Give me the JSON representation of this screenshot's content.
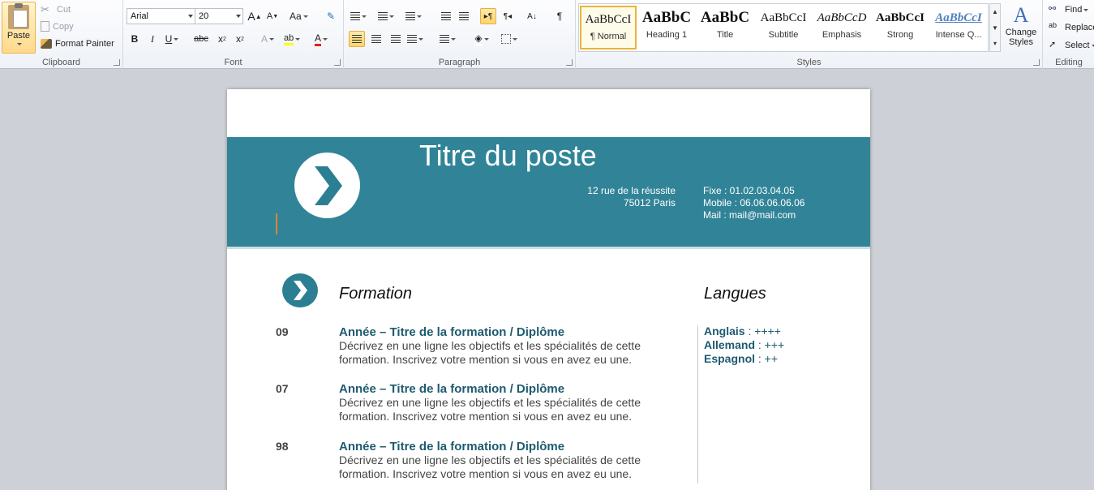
{
  "ribbon": {
    "clipboard": {
      "label": "Clipboard",
      "paste": "Paste",
      "cut": "Cut",
      "copy": "Copy",
      "format_painter": "Format Painter"
    },
    "font": {
      "label": "Font",
      "family": "Arial",
      "size": "20",
      "grow": "A",
      "shrink": "A",
      "change_case": "Aa",
      "bold": "B",
      "italic": "I",
      "underline": "U",
      "strike": "abc",
      "subscript": "x",
      "superscript": "x",
      "font_color": "A"
    },
    "paragraph": {
      "label": "Paragraph",
      "pilcrow": "¶"
    },
    "styles": {
      "label": "Styles",
      "items": [
        {
          "sample": "AaBbCcI",
          "name": "¶ Normal"
        },
        {
          "sample": "AaBbC",
          "name": "Heading 1"
        },
        {
          "sample": "AaBbC",
          "name": "Title"
        },
        {
          "sample": "AaBbCcI",
          "name": "Subtitle"
        },
        {
          "sample": "AaBbCcD",
          "name": "Emphasis"
        },
        {
          "sample": "AaBbCcI",
          "name": "Strong"
        },
        {
          "sample": "AaBbCcI",
          "name": "Intense Q..."
        }
      ],
      "change_styles": "Change Styles"
    },
    "editing": {
      "label": "Editing",
      "find": "Find",
      "replace": "Replace",
      "select": "Select"
    }
  },
  "document": {
    "job_title": "Titre du poste",
    "address_line1": "12 rue de la réussite",
    "address_line2": "75012 Paris",
    "phone_fixed": "Fixe : 01.02.03.04.05",
    "phone_mobile": "Mobile : 06.06.06.06.06",
    "mail": "Mail : mail@mail.com",
    "formation_title": "Formation",
    "langues_title": "Langues",
    "entries": [
      {
        "year": "09",
        "title": "Année – Titre de la formation / Diplôme",
        "desc1": "Décrivez en une ligne les objectifs et les spécialités de cette",
        "desc2": "formation. Inscrivez votre mention si vous en avez eu une."
      },
      {
        "year": "07",
        "title": "Année – Titre de la formation / Diplôme",
        "desc1": "Décrivez en une ligne les objectifs et les spécialités de cette",
        "desc2": "formation. Inscrivez votre mention si vous en avez eu une."
      },
      {
        "year": "98",
        "title": "Année – Titre de la formation / Diplôme",
        "desc1": "Décrivez en une ligne les objectifs et les spécialités de cette",
        "desc2": "formation. Inscrivez votre mention si vous en avez eu une."
      }
    ],
    "languages": [
      {
        "name": "Anglais",
        "level": " : ++++"
      },
      {
        "name": "Allemand",
        "level": " : +++"
      },
      {
        "name": "Espagnol",
        "level": " : ++"
      }
    ]
  },
  "colors": {
    "banner": "#318497",
    "accent_text": "#1e5a70",
    "page_bg": "#cdd0d6"
  }
}
